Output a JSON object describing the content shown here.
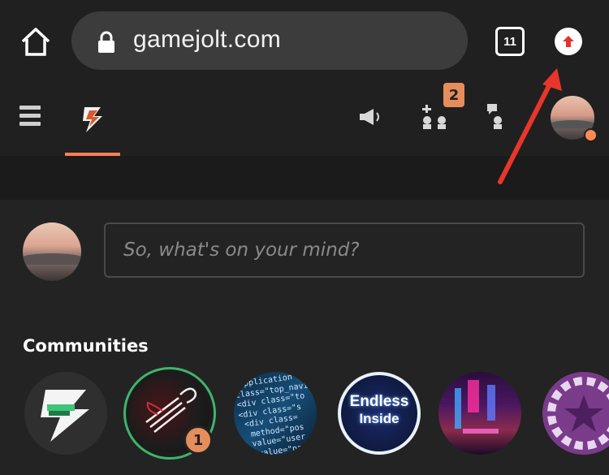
{
  "browser": {
    "url": "gamejolt.com",
    "tab_count": "11",
    "icons": [
      "home-icon",
      "lock-icon",
      "tabs-icon",
      "update-icon"
    ]
  },
  "header": {
    "friend_requests_count": "2",
    "icons": [
      "menu-icon",
      "gamejolt-bolt-icon",
      "megaphone-icon",
      "friend-requests-icon",
      "chat-icon"
    ],
    "accent_color": "#ff7f57"
  },
  "composer": {
    "placeholder": "So, what's on your mind?"
  },
  "communities": {
    "title": "Communities",
    "items": [
      {
        "name": "Game Jolt"
      },
      {
        "name": "Art",
        "unread": "1"
      },
      {
        "name": "Code"
      },
      {
        "name": "Endless Inside",
        "logo_line1": "Endless",
        "logo_line2": "Inside"
      },
      {
        "name": "Neon"
      },
      {
        "name": "Purple"
      }
    ]
  }
}
